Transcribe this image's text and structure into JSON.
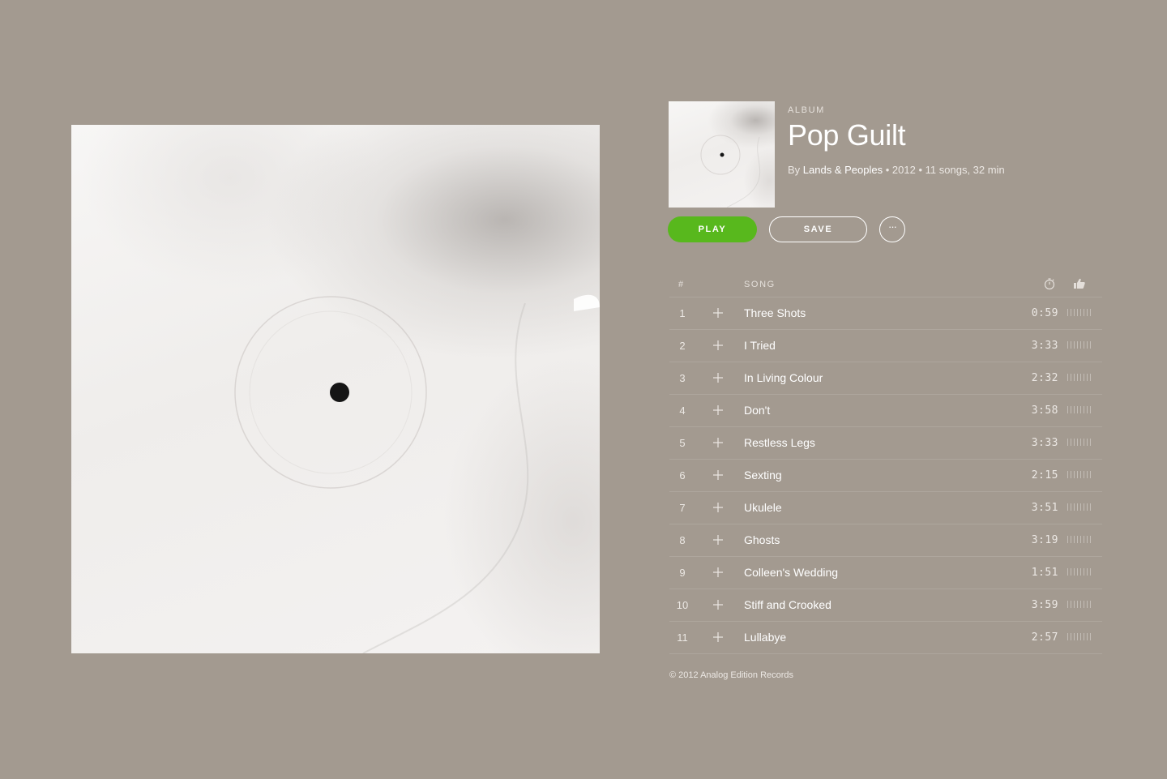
{
  "album": {
    "type_label": "ALBUM",
    "title": "Pop Guilt",
    "by_label": "By",
    "artist": "Lands & Peoples",
    "separator": "•",
    "year": "2012",
    "summary": "11 songs, 32 min"
  },
  "actions": {
    "play_label": "PLAY",
    "save_label": "SAVE",
    "more_label": "···"
  },
  "table": {
    "header_num": "#",
    "header_song": "SONG",
    "time_icon": "stopwatch-icon",
    "popularity_icon": "thumbs-up-icon"
  },
  "tracks": [
    {
      "num": "1",
      "title": "Three Shots",
      "duration": "0:59"
    },
    {
      "num": "2",
      "title": "I Tried",
      "duration": "3:33"
    },
    {
      "num": "3",
      "title": "In Living Colour",
      "duration": "2:32"
    },
    {
      "num": "4",
      "title": "Don't",
      "duration": "3:58"
    },
    {
      "num": "5",
      "title": "Restless Legs",
      "duration": "3:33"
    },
    {
      "num": "6",
      "title": "Sexting",
      "duration": "2:15"
    },
    {
      "num": "7",
      "title": "Ukulele",
      "duration": "3:51"
    },
    {
      "num": "8",
      "title": "Ghosts",
      "duration": "3:19"
    },
    {
      "num": "9",
      "title": "Colleen's Wedding",
      "duration": "1:51"
    },
    {
      "num": "10",
      "title": "Stiff and Crooked",
      "duration": "3:59"
    },
    {
      "num": "11",
      "title": "Lullabye",
      "duration": "2:57"
    }
  ],
  "footer": {
    "copyright": "© 2012 Analog Edition Records"
  },
  "colors": {
    "background": "#a39a90",
    "play_button": "#58b81d",
    "text": "#ffffff"
  }
}
